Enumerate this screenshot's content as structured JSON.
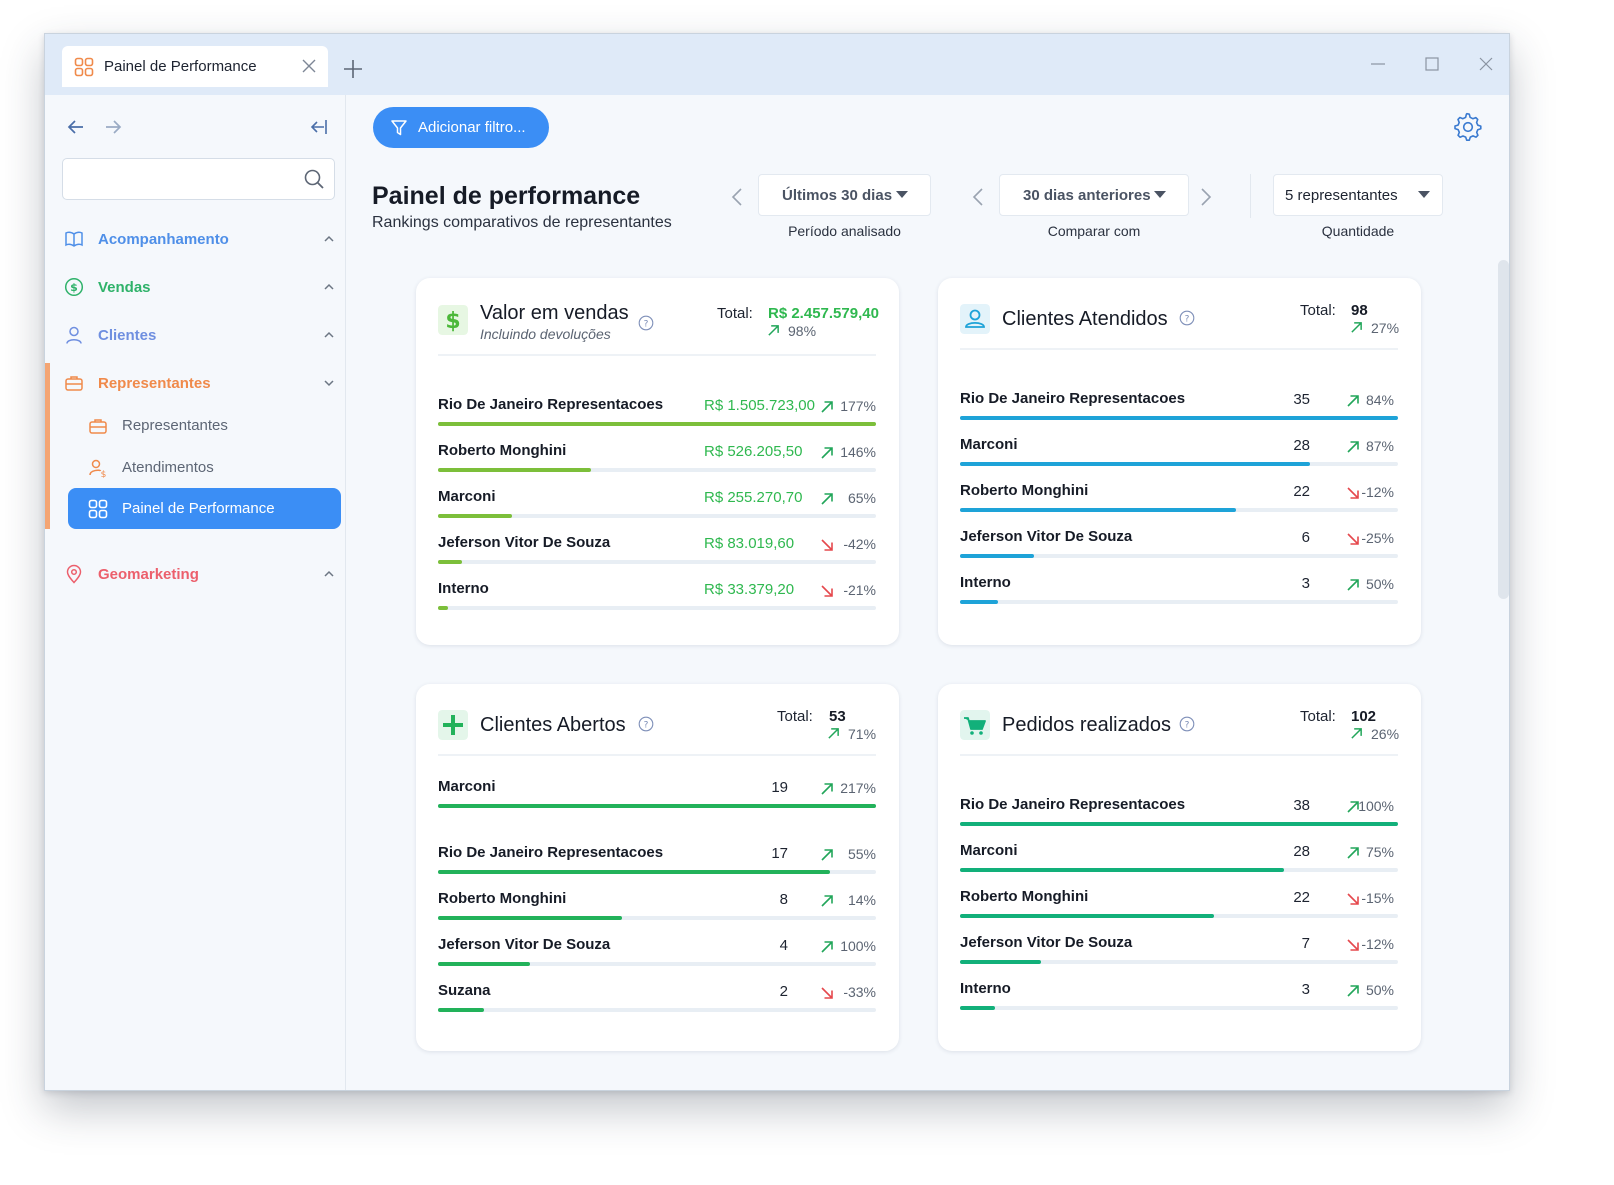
{
  "window": {
    "tab_title": "Painel de Performance"
  },
  "sidebar": {
    "search_placeholder": "",
    "sections": [
      {
        "label": "Acompanhamento",
        "color": "#4f8fe8",
        "icon": "book-icon"
      },
      {
        "label": "Vendas",
        "color": "#2fb26a",
        "icon": "dollar-circle-icon"
      },
      {
        "label": "Clientes",
        "color": "#6f8fe0",
        "icon": "user-icon"
      },
      {
        "label": "Representantes",
        "color": "#f08a4b",
        "icon": "briefcase-icon"
      },
      {
        "label": "Geomarketing",
        "color": "#ec5f6c",
        "icon": "map-pin-icon"
      }
    ],
    "sub_items": [
      {
        "label": "Representantes",
        "icon": "briefcase-icon"
      },
      {
        "label": "Atendimentos",
        "icon": "user-dollar-icon"
      },
      {
        "label": "Painel de Performance",
        "icon": "dashboard-grid-icon",
        "active": true
      }
    ]
  },
  "toolbar": {
    "filter_label": "Adicionar filtro..."
  },
  "header": {
    "title": "Painel de performance",
    "subtitle": "Rankings comparativos de representantes"
  },
  "controls": {
    "period": {
      "value": "Últimos 30 dias",
      "label": "Período analisado"
    },
    "compare": {
      "value": "30 dias anteriores",
      "label": "Comparar com"
    },
    "quantity": {
      "value": "5 representantes",
      "label": "Quantidade"
    }
  },
  "colors": {
    "accent": "#3b8ef5",
    "money": "#2fb84f",
    "up": "#22a65a",
    "down": "#e5484d",
    "bar_sales": "#7cbf3a",
    "bar_attended": "#1ea3d8",
    "bar_open": "#22b25a",
    "bar_orders": "#12b07a"
  },
  "cards": [
    {
      "title": "Valor em vendas",
      "subtitle": "Incluindo devoluções",
      "icon": "dollar-icon",
      "total_label": "Total:",
      "total": "R$ 2.457.579,40",
      "total_pct": "98%",
      "rows": [
        {
          "name": "Rio De Janeiro Representacoes",
          "value": "R$ 1.505.723,00",
          "trend": "up",
          "pct": "177%",
          "fill": 1.0
        },
        {
          "name": "Roberto Monghini",
          "value": "R$ 526.205,50",
          "trend": "up",
          "pct": "146%",
          "fill": 0.35
        },
        {
          "name": "Marconi",
          "value": "R$ 255.270,70",
          "trend": "up",
          "pct": "65%",
          "fill": 0.17
        },
        {
          "name": "Jeferson Vitor De Souza",
          "value": "R$ 83.019,60",
          "trend": "down",
          "pct": "-42%",
          "fill": 0.055
        },
        {
          "name": "Interno",
          "value": "R$ 33.379,20",
          "trend": "down",
          "pct": "-21%",
          "fill": 0.022
        }
      ]
    },
    {
      "title": "Clientes Atendidos",
      "subtitle": "",
      "icon": "user-card-icon",
      "total_label": "Total:",
      "total": "98",
      "total_pct": "27%",
      "rows": [
        {
          "name": "Rio De Janeiro Representacoes",
          "value": "35",
          "trend": "up",
          "pct": "84%",
          "fill": 1.0
        },
        {
          "name": "Marconi",
          "value": "28",
          "trend": "up",
          "pct": "87%",
          "fill": 0.8
        },
        {
          "name": "Roberto Monghini",
          "value": "22",
          "trend": "down",
          "pct": "-12%",
          "fill": 0.63
        },
        {
          "name": "Jeferson Vitor De Souza",
          "value": "6",
          "trend": "down",
          "pct": "-25%",
          "fill": 0.17
        },
        {
          "name": "Interno",
          "value": "3",
          "trend": "up",
          "pct": "50%",
          "fill": 0.086
        }
      ]
    },
    {
      "title": "Clientes Abertos",
      "subtitle": "",
      "icon": "plus-icon",
      "total_label": "Total:",
      "total": "53",
      "total_pct": "71%",
      "rows": [
        {
          "name": "Marconi",
          "value": "19",
          "trend": "up",
          "pct": "217%",
          "fill": 1.0
        },
        {
          "name": "Rio De Janeiro Representacoes",
          "value": "17",
          "trend": "up",
          "pct": "55%",
          "fill": 0.895
        },
        {
          "name": "Roberto Monghini",
          "value": "8",
          "trend": "up",
          "pct": "14%",
          "fill": 0.42
        },
        {
          "name": "Jeferson Vitor De Souza",
          "value": "4",
          "trend": "up",
          "pct": "100%",
          "fill": 0.21
        },
        {
          "name": "Suzana",
          "value": "2",
          "trend": "down",
          "pct": "-33%",
          "fill": 0.105
        }
      ]
    },
    {
      "title": "Pedidos realizados",
      "subtitle": "",
      "icon": "cart-icon",
      "total_label": "Total:",
      "total": "102",
      "total_pct": "26%",
      "rows": [
        {
          "name": "Rio De Janeiro Representacoes",
          "value": "38",
          "trend": "up",
          "pct": "100%",
          "fill": 1.0
        },
        {
          "name": "Marconi",
          "value": "28",
          "trend": "up",
          "pct": "75%",
          "fill": 0.74
        },
        {
          "name": "Roberto Monghini",
          "value": "22",
          "trend": "down",
          "pct": "-15%",
          "fill": 0.58
        },
        {
          "name": "Jeferson Vitor De Souza",
          "value": "7",
          "trend": "down",
          "pct": "-12%",
          "fill": 0.184
        },
        {
          "name": "Interno",
          "value": "3",
          "trend": "up",
          "pct": "50%",
          "fill": 0.079
        }
      ]
    }
  ]
}
